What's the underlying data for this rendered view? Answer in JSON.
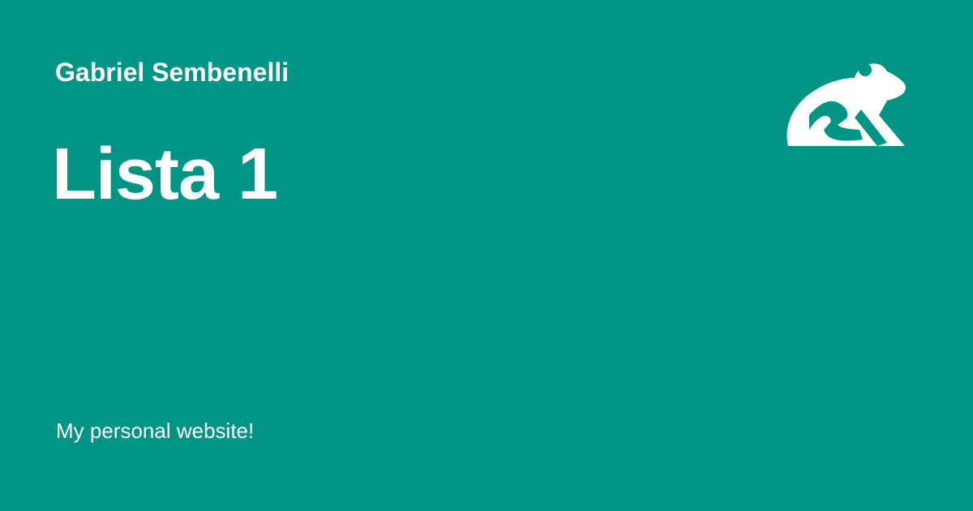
{
  "page": {
    "background_color": "#009485",
    "text_color": "#ffffff"
  },
  "header": {
    "author": "Gabriel Sembenelli"
  },
  "main": {
    "title": "Lista 1"
  },
  "footer": {
    "tagline": "My personal website!"
  },
  "logo": {
    "icon": "frog-icon"
  }
}
